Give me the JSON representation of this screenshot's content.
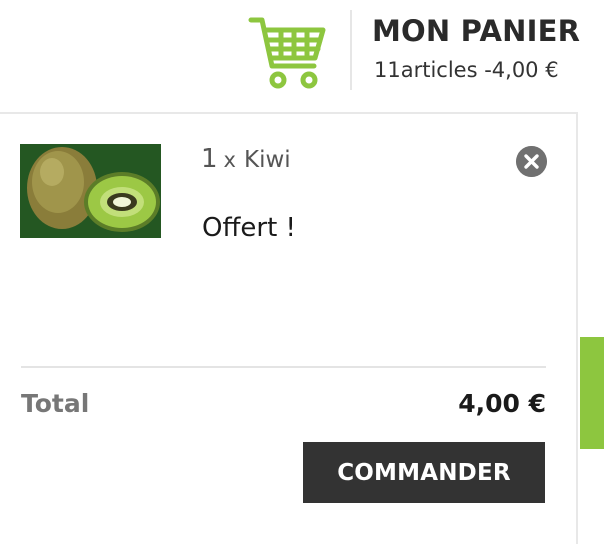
{
  "header": {
    "title": "MON PANIER",
    "summary": "11articles -4,00 €",
    "cart_icon": "shopping-cart-icon",
    "accent_color": "#8dc63f"
  },
  "item": {
    "quantity": "1",
    "times": "x",
    "name": "Kiwi",
    "price_text": "Offert !",
    "image": "kiwi-image",
    "remove_icon": "close-icon"
  },
  "total": {
    "label": "Total",
    "value": "4,00 €"
  },
  "checkout": {
    "label": "COMMANDER"
  }
}
